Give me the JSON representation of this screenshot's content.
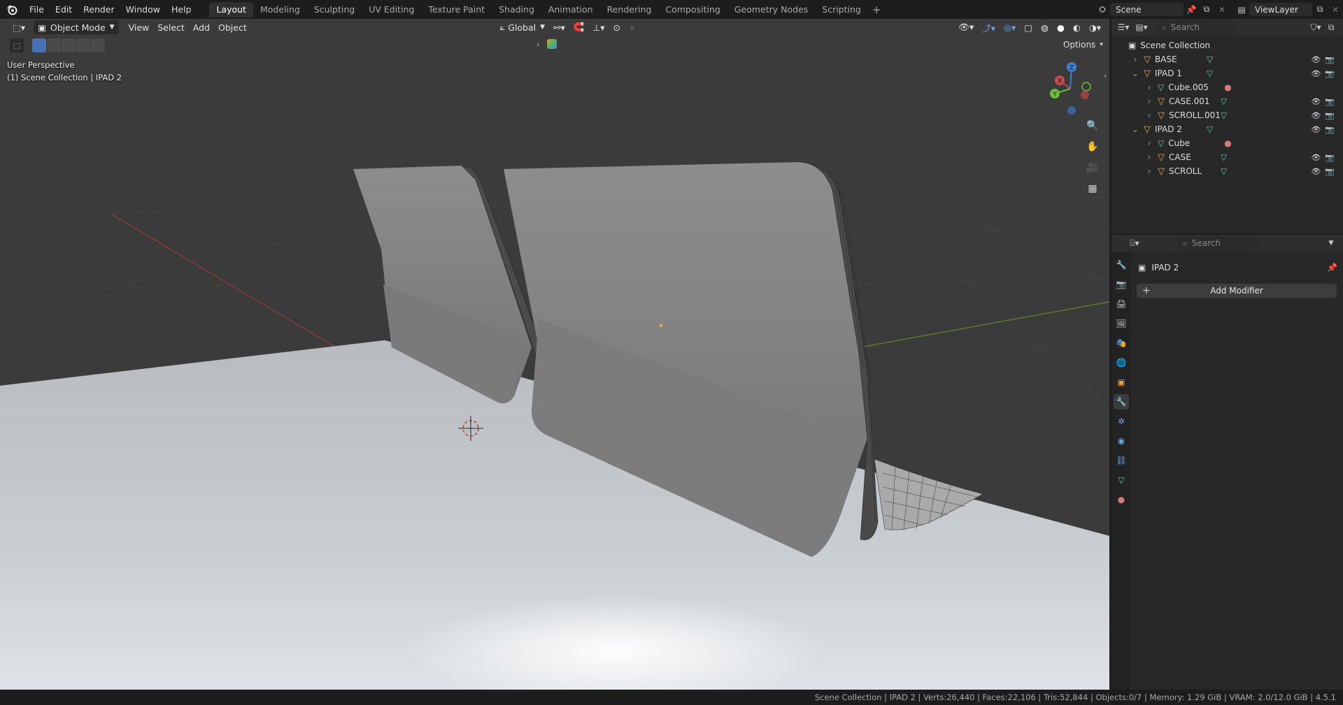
{
  "menu": {
    "items": [
      "File",
      "Edit",
      "Render",
      "Window",
      "Help"
    ]
  },
  "workspaces": [
    "Layout",
    "Modeling",
    "Sculpting",
    "UV Editing",
    "Texture Paint",
    "Shading",
    "Animation",
    "Rendering",
    "Compositing",
    "Geometry Nodes",
    "Scripting"
  ],
  "active_workspace": "Layout",
  "top_right": {
    "scene": "Scene",
    "view_layer": "ViewLayer"
  },
  "viewport": {
    "mode": "Object Mode",
    "menus": [
      "View",
      "Select",
      "Add",
      "Object"
    ],
    "orientation": "Global",
    "options_label": "Options",
    "perspective_label": "User Perspective",
    "context_label": "(1) Scene Collection | IPAD 2",
    "gizmo_axes": [
      "X",
      "Y",
      "Z"
    ]
  },
  "outliner": {
    "search_placeholder": "Search",
    "root": "Scene Collection",
    "rows": [
      {
        "name": "BASE",
        "type": "object",
        "indent": 1,
        "expanded": false,
        "visible_toggles": true
      },
      {
        "name": "IPAD 1",
        "type": "object",
        "indent": 1,
        "expanded": true,
        "visible_toggles": true
      },
      {
        "name": "Cube.005",
        "type": "mesh-child",
        "indent": 2,
        "expanded": false,
        "visible_toggles": false,
        "material": true
      },
      {
        "name": "CASE.001",
        "type": "object",
        "indent": 2,
        "expanded": false,
        "visible_toggles": true
      },
      {
        "name": "SCROLL.001",
        "type": "object",
        "indent": 2,
        "expanded": false,
        "visible_toggles": true
      },
      {
        "name": "IPAD 2",
        "type": "object",
        "indent": 1,
        "expanded": true,
        "visible_toggles": true,
        "selected": true
      },
      {
        "name": "Cube",
        "type": "mesh-child",
        "indent": 2,
        "expanded": false,
        "visible_toggles": false,
        "material": true
      },
      {
        "name": "CASE",
        "type": "object",
        "indent": 2,
        "expanded": false,
        "visible_toggles": true
      },
      {
        "name": "SCROLL",
        "type": "object",
        "indent": 2,
        "expanded": false,
        "visible_toggles": true
      }
    ]
  },
  "properties": {
    "search_placeholder": "Search",
    "object_name": "IPAD 2",
    "add_modifier_label": "Add Modifier",
    "tabs": [
      "tool-icon",
      "render-icon",
      "output-icon",
      "view-layer-icon",
      "scene-icon",
      "world-icon",
      "object-icon",
      "modifier-icon",
      "particles-icon",
      "physics-icon",
      "constraints-icon",
      "data-icon",
      "material-icon"
    ],
    "active_tab": "modifier-icon"
  },
  "status": {
    "text": "Scene Collection | IPAD 2 | Verts:26,440 | Faces:22,106 | Tris:52,844 | Objects:0/7 | Memory: 1.29 GiB | VRAM: 2.0/12.0 GiB | 4.5.1"
  },
  "colors": {
    "accent": "#4772b3",
    "object_icon": "#f0a044",
    "mesh_icon": "#4dd69c",
    "material_icon": "#d97979"
  }
}
